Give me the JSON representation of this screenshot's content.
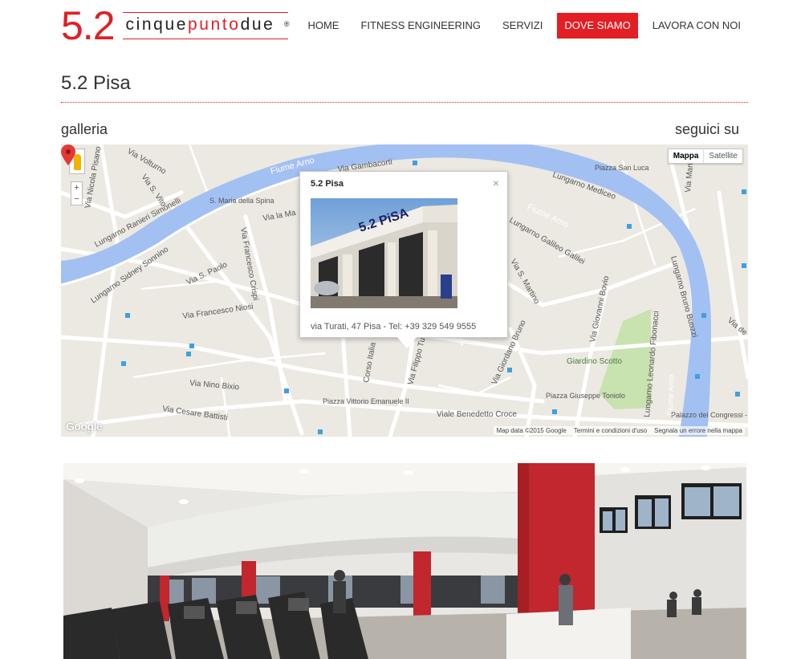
{
  "brand": {
    "number": "5.2",
    "word_left": "cinque",
    "word_mid": "punto",
    "word_right": "due",
    "reg": "®",
    "accent": "#e31e24"
  },
  "nav": [
    {
      "label": "HOME",
      "active": false
    },
    {
      "label": "FITNESS ENGINEERING",
      "active": false
    },
    {
      "label": "SERVIZI",
      "active": false
    },
    {
      "label": "DOVE SIAMO",
      "active": true
    },
    {
      "label": "LAVORA CON NOI",
      "active": false
    }
  ],
  "page": {
    "title": "5.2 Pisa",
    "left_heading": "galleria",
    "right_heading": "seguici su"
  },
  "map": {
    "type_buttons": {
      "map": "Mappa",
      "satellite": "Satellite"
    },
    "zoom_in": "+",
    "zoom_out": "−",
    "popup": {
      "title": "5.2 Pisa",
      "close": "×",
      "address": "via Turati, 47 Pisa - Tel: +39 329 549 9555",
      "sign_text": "5.2 PiSA"
    },
    "labels": [
      "Fiume Arno",
      "Via Gambacorti",
      "Lungarno Mediceo",
      "Piazza San Luca",
      "Via Volturno",
      "Via S. Vito",
      "Via Nicola Pisano",
      "Lungarno Ranieri Simonelli",
      "S. Maria della Spina",
      "Via la Ma",
      "Lungarno Sidney Sonnino",
      "Via S. Paolo",
      "Via Francesco Crispi",
      "Via Francesco Niosi",
      "Lungarno Galileo Galilei",
      "Via S. Martino",
      "Via Giovanni Bovio",
      "Via Giordano Bruno",
      "Giardino Scotto",
      "Lungarno Leonardo Fibonacci",
      "Lungarno Bruno Buozzi",
      "Via Nino Bixio",
      "Via Cesare Battisti",
      "Piazza Vittorio Emanuele II",
      "Viale Benedetto Croce",
      "Piazza Giuseppe Toniolo",
      "Corso Italia",
      "Via Filippo Turati",
      "Palazzo dei Congressi - PISA",
      "Via Marta",
      "Via de"
    ],
    "footer": {
      "data": "Map data ©2015 Google",
      "terms": "Termini e condizioni d'uso",
      "report": "Segnala un errore nella mappa"
    },
    "google_logo": "Google"
  },
  "colors": {
    "river": "#a3c0f2",
    "road": "#ffffff",
    "land": "#ece9e2",
    "park": "#c8e2b0"
  }
}
